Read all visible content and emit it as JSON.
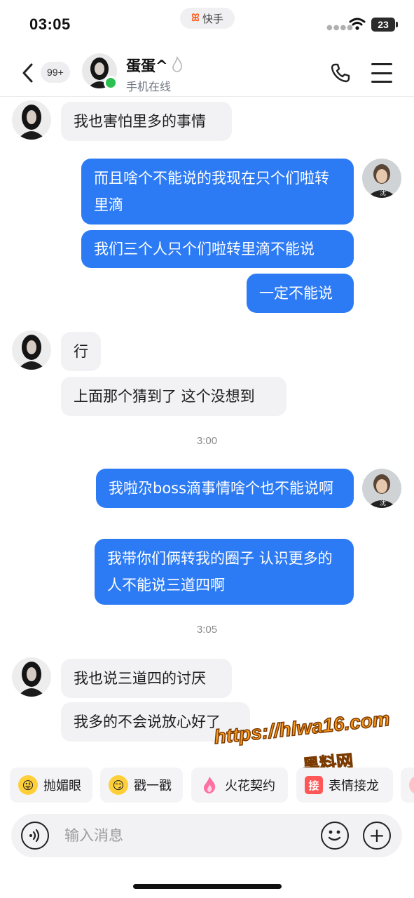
{
  "status_bar": {
    "time": "03:05",
    "app_name": "快手",
    "battery": "23"
  },
  "header": {
    "unread_count": "99+",
    "contact_name": "蛋蛋^",
    "contact_status": "手机在线"
  },
  "messages": [
    {
      "side": "in",
      "text": "我也害怕里多的事情"
    },
    {
      "side": "out",
      "text": "而且啥个不能说的我现在只个们啦转里滴"
    },
    {
      "side": "out",
      "text": "我们三个人只个们啦转里滴不能说"
    },
    {
      "side": "out",
      "text": "一定不能说"
    },
    {
      "side": "in",
      "text": "行"
    },
    {
      "side": "in",
      "text": "上面那个猜到了 这个没想到"
    },
    {
      "side": "out",
      "text": "我啦尕boss滴事情啥个也不能说啊"
    },
    {
      "side": "out",
      "text": "我带你们俩转我的圈子 认识更多的人不能说三道四啊"
    },
    {
      "side": "in",
      "text": "我也说三道四的讨厌"
    },
    {
      "side": "in",
      "text": "我多的不会说放心好了"
    }
  ],
  "timestamps": [
    "3:00",
    "3:05"
  ],
  "watermark": {
    "url": "https://hlwa16.com",
    "site": "黑料网"
  },
  "quick_replies": [
    {
      "label": "抛媚眼",
      "icon": "wink-face-icon"
    },
    {
      "label": "戳一戳",
      "icon": "poke-face-icon"
    },
    {
      "label": "火花契约",
      "icon": "flame-icon"
    },
    {
      "label": "表情接龙",
      "icon": "jie-box-icon",
      "icon_text": "接"
    }
  ],
  "input": {
    "placeholder": "输入消息"
  },
  "colors": {
    "outgoing_bubble": "#2d7bf4",
    "incoming_bubble": "#f2f2f4",
    "online": "#2bc04f",
    "accent": "#ff5a1f"
  }
}
